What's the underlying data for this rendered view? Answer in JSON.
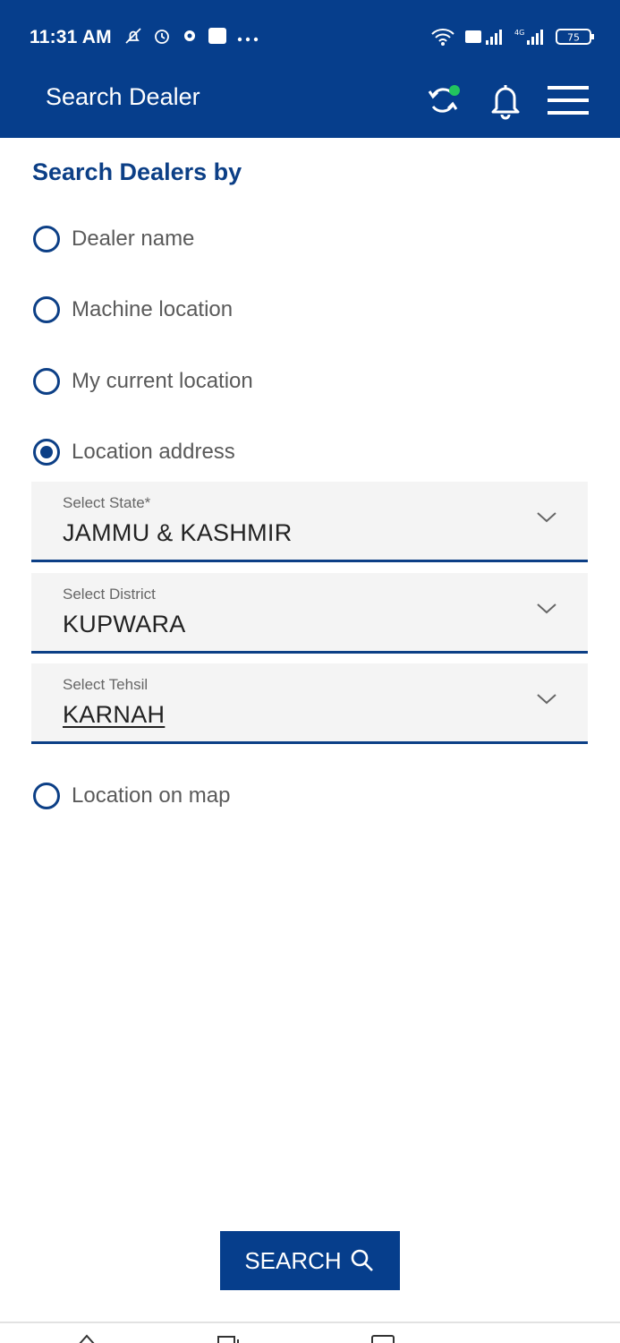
{
  "status_bar": {
    "time": "11:31 AM",
    "icons_left": [
      "notification-off-icon",
      "alarm-icon",
      "settings-icon",
      "app-badge-icon",
      "more-icon"
    ],
    "icons_right": [
      "wifi-icon",
      "signal-icon",
      "signal-icon",
      "battery-icon"
    ],
    "battery": "75",
    "network": "4G"
  },
  "app_bar": {
    "title": "Search Dealer",
    "accent_dot_color": "#22c55e"
  },
  "page": {
    "section_title": "Search Dealers by",
    "options": [
      {
        "label": "Dealer name",
        "checked": false
      },
      {
        "label": "Machine location",
        "checked": false
      },
      {
        "label": "My current location",
        "checked": false
      },
      {
        "label": "Location address",
        "checked": true
      },
      {
        "label": "Location on map",
        "checked": false
      }
    ],
    "selects": [
      {
        "label": "Select State*",
        "value": "JAMMU & KASHMIR"
      },
      {
        "label": "Select District",
        "value": "KUPWARA"
      },
      {
        "label": "Select Tehsil",
        "value": "KARNAH"
      }
    ],
    "search_button": "SEARCH"
  },
  "colors": {
    "primary": "#063e8c",
    "text_blue": "#0c3f86",
    "field_bg": "#f4f4f4"
  }
}
